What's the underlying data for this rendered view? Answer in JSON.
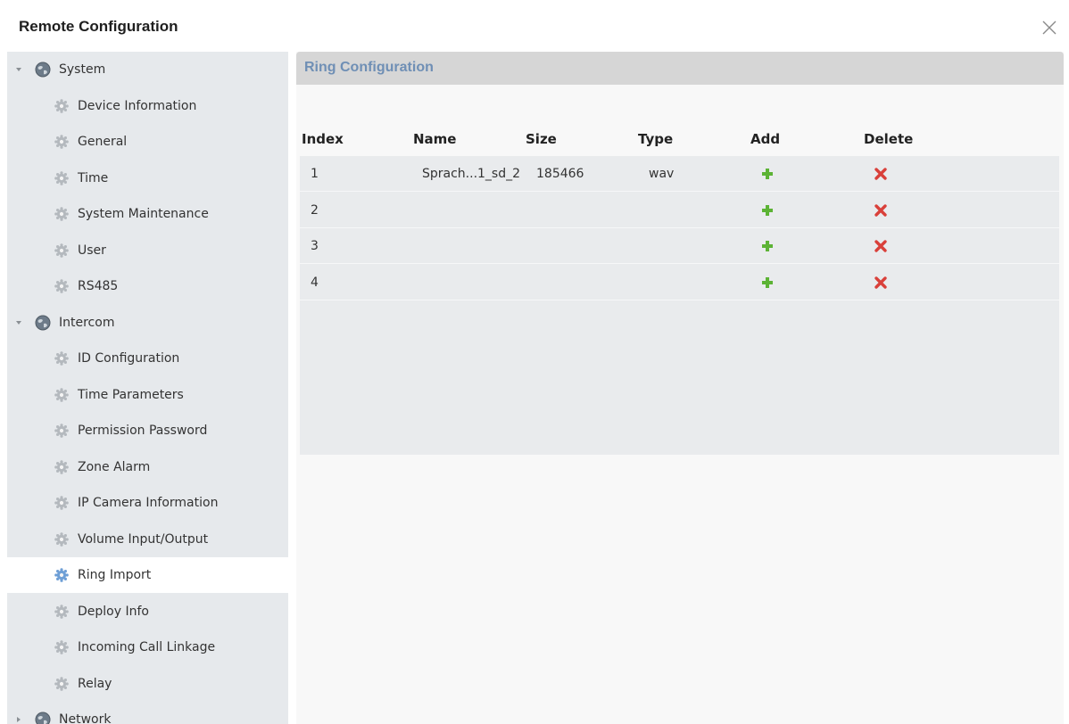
{
  "window": {
    "title": "Remote Configuration",
    "close_icon": "close-icon"
  },
  "sidebar": {
    "items": [
      {
        "label": "System",
        "level": 0,
        "expanded": true,
        "icon": "globe-icon"
      },
      {
        "label": "Device Information",
        "level": 1,
        "icon": "gear-icon"
      },
      {
        "label": "General",
        "level": 1,
        "icon": "gear-icon"
      },
      {
        "label": "Time",
        "level": 1,
        "icon": "gear-icon"
      },
      {
        "label": "System Maintenance",
        "level": 1,
        "icon": "gear-icon"
      },
      {
        "label": "User",
        "level": 1,
        "icon": "gear-icon"
      },
      {
        "label": "RS485",
        "level": 1,
        "icon": "gear-icon"
      },
      {
        "label": "Intercom",
        "level": 0,
        "expanded": true,
        "icon": "globe-icon"
      },
      {
        "label": "ID Configuration",
        "level": 1,
        "icon": "gear-icon"
      },
      {
        "label": "Time Parameters",
        "level": 1,
        "icon": "gear-icon"
      },
      {
        "label": "Permission Password",
        "level": 1,
        "icon": "gear-icon"
      },
      {
        "label": "Zone Alarm",
        "level": 1,
        "icon": "gear-icon"
      },
      {
        "label": "IP Camera Information",
        "level": 1,
        "icon": "gear-icon"
      },
      {
        "label": "Volume Input/Output",
        "level": 1,
        "icon": "gear-icon"
      },
      {
        "label": "Ring Import",
        "level": 1,
        "selected": true,
        "icon": "gear-icon"
      },
      {
        "label": "Deploy Info",
        "level": 1,
        "icon": "gear-icon"
      },
      {
        "label": "Incoming Call Linkage",
        "level": 1,
        "icon": "gear-icon"
      },
      {
        "label": "Relay",
        "level": 1,
        "icon": "gear-icon"
      },
      {
        "label": "Network",
        "level": 0,
        "expanded": false,
        "icon": "globe-icon"
      }
    ]
  },
  "panel": {
    "title": "Ring Configuration",
    "columns": [
      "Index",
      "Name",
      "Size",
      "Type",
      "Add",
      "Delete"
    ],
    "rows": [
      {
        "index": "1",
        "name": "Sprach...1_sd_2",
        "size": "185466",
        "type": "wav"
      },
      {
        "index": "2",
        "name": "",
        "size": "",
        "type": ""
      },
      {
        "index": "3",
        "name": "",
        "size": "",
        "type": ""
      },
      {
        "index": "4",
        "name": "",
        "size": "",
        "type": ""
      }
    ]
  },
  "colors": {
    "header_text": "#6f8fb5",
    "add_green": "#5cb335",
    "delete_red": "#d9403a",
    "selected_bg": "#ffffff",
    "sidebar_bg": "#e6e9ec"
  }
}
